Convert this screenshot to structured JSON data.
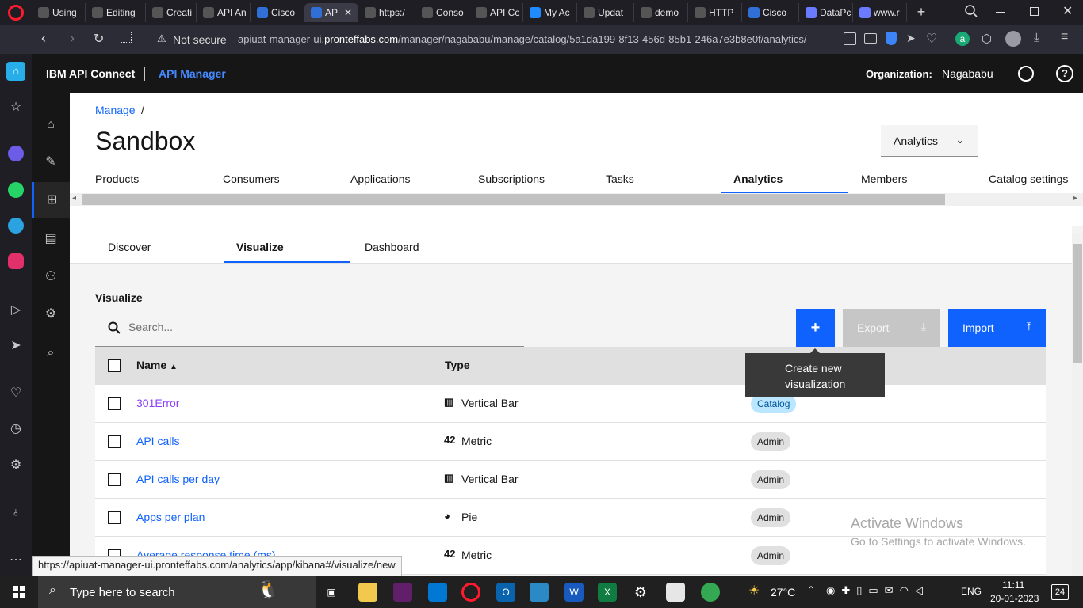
{
  "browser": {
    "tabs": [
      {
        "label": "Using",
        "color": "#ffffff"
      },
      {
        "label": "Editing",
        "color": "#ffffff"
      },
      {
        "label": "Creati",
        "color": "#ffffff"
      },
      {
        "label": "API An",
        "color": "#ffffff"
      },
      {
        "label": "Cisco",
        "color": "#ffffff"
      },
      {
        "label": "AP",
        "color": "#ffffff"
      },
      {
        "label": "https:/",
        "color": "#ffffff"
      },
      {
        "label": "Conso",
        "color": "#ffffff"
      },
      {
        "label": "API Cc",
        "color": "#ffffff"
      },
      {
        "label": "My Ac",
        "color": "#ffffff"
      },
      {
        "label": "Updat",
        "color": "#ffffff"
      },
      {
        "label": "demo",
        "color": "#ffffff"
      },
      {
        "label": "HTTP",
        "color": "#ffffff"
      },
      {
        "label": "Cisco",
        "color": "#ffffff"
      },
      {
        "label": "DataPc",
        "color": "#ffffff"
      },
      {
        "label": "www.r",
        "color": "#ffffff"
      }
    ],
    "not_secure": "Not secure",
    "url_host": "apiuat-manager-ui.pronteffabs.com",
    "url_prefix": "apiuat-manager-ui.",
    "url_host_bold": "pronteffabs.com",
    "url_path": "/manager/nagababu/manage/catalog/5a1da199-8f13-456d-85b1-246a7e3b8e0f/analytics/",
    "status_url": "https://apiuat-manager-ui.pronteffabs.com/analytics/app/kibana#/visualize/new"
  },
  "header": {
    "product": "IBM API Connect",
    "app": "API Manager",
    "org_label": "Organization:",
    "org_value": "Nagababu"
  },
  "page": {
    "breadcrumb": "Manage",
    "breadcrumb_sep": "/",
    "title": "Sandbox",
    "view_select": "Analytics",
    "tabs": [
      "Products",
      "Consumers",
      "Applications",
      "Subscriptions",
      "Tasks",
      "Analytics",
      "Members",
      "Catalog settings"
    ],
    "active_tab": "Analytics",
    "subtabs": [
      "Discover",
      "Visualize",
      "Dashboard"
    ],
    "active_subtab": "Visualize",
    "section_title": "Visualize",
    "search_placeholder": "Search...",
    "create_tooltip": "Create new visualization",
    "export_label": "Export",
    "import_label": "Import",
    "columns": {
      "name": "Name",
      "type": "Type"
    },
    "rows": [
      {
        "name": "301Error",
        "type": "Vertical Bar",
        "type_icon": "bar-chart-icon",
        "tag": "Catalog"
      },
      {
        "name": "API calls",
        "type": "Metric",
        "type_icon": "metric-42-icon",
        "tag": "Admin"
      },
      {
        "name": "API calls per day",
        "type": "Vertical Bar",
        "type_icon": "bar-chart-icon",
        "tag": "Admin"
      },
      {
        "name": "Apps per plan",
        "type": "Pie",
        "type_icon": "pie-icon",
        "tag": "Admin"
      },
      {
        "name": "Average response time (ms)",
        "type": "Metric",
        "type_icon": "metric-42-icon",
        "tag": "Admin"
      }
    ]
  },
  "watermark": {
    "line1": "Activate Windows",
    "line2": "Go to Settings to activate Windows."
  },
  "taskbar": {
    "search_placeholder": "Type here to search",
    "weather": "27°C",
    "lang": "ENG",
    "time": "11:11",
    "date": "20-01-2023",
    "notifications": "24"
  },
  "colors": {
    "accent": "#0f62fe",
    "ibm_dark": "#161616"
  }
}
